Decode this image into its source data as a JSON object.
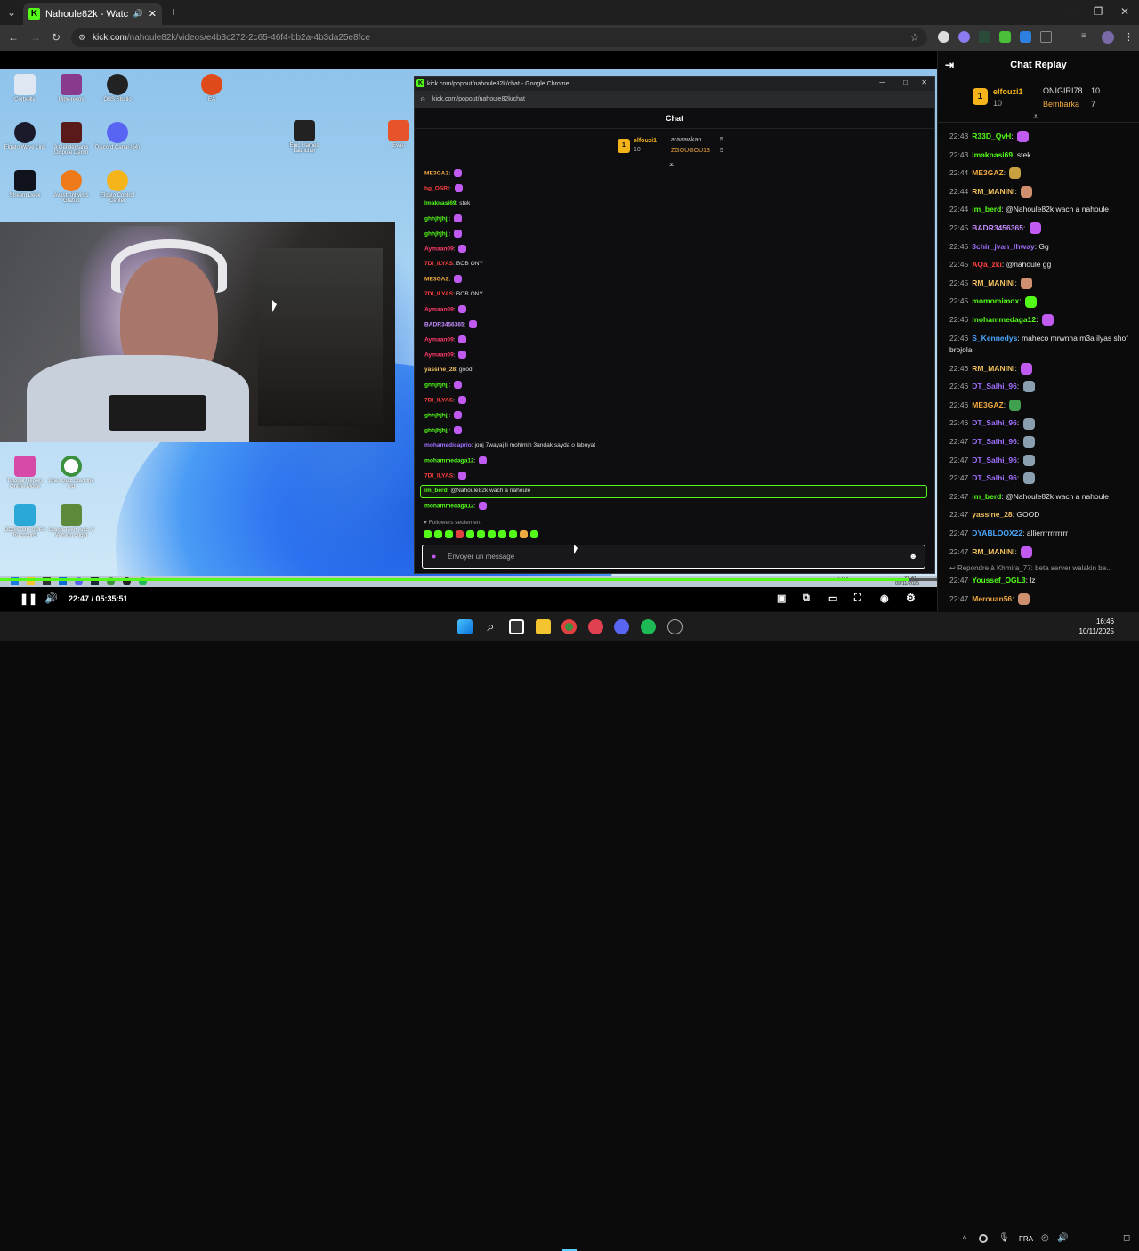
{
  "browser": {
    "tab_title": "Nahoule82k - Watch the VO",
    "url_domain": "kick.com",
    "url_path": "/nahoule82k/videos/e4b3c272-2c65-46f4-bb2a-4b3da25e8fce"
  },
  "desktop_icons": [
    "Corbeille",
    "Ujpy-recov",
    "OBS Studio",
    "EA",
    "Elgato Wave Link",
    "A Gentleman's Dispute Demo",
    "Discord Canal (64)",
    "Epic Games Launcher",
    "Evan",
    "Stream Deck",
    "Avast Antivirus Gratuit",
    "Elgato Control Center",
    "Tutorial Heroes Online Mode",
    "Uber Quiz Start the old",
    "DESKTOP-SUP4 Raccourci",
    "Grand Theft Auto V Version origin"
  ],
  "popout": {
    "title": "kick.com/popout/nahoule82k/chat - Google Chrome",
    "url": "kick.com/popout/nahoule82k/chat",
    "header": "Chat",
    "top_gifters": [
      {
        "rank": "1",
        "name": "elfouzi1",
        "count": "10"
      },
      {
        "name": "araaawkan",
        "count": "5"
      },
      {
        "name": "ZGOUGOU13",
        "count": "5"
      }
    ],
    "messages": [
      {
        "user": "ME3GAZ",
        "text": "",
        "color": "#f0a840"
      },
      {
        "user": "bg_OSRI",
        "text": "",
        "color": "#ff4040"
      },
      {
        "user": "lmaknasi69",
        "text": "stek",
        "color": "#53fc18"
      },
      {
        "user": "ghhjhjhjj",
        "text": "",
        "color": "#53fc18"
      },
      {
        "user": "ghhjhjhjj",
        "text": "",
        "color": "#53fc18"
      },
      {
        "user": "Aymaan09",
        "text": "",
        "color": "#ff3a6a"
      },
      {
        "user": "7DI_ILYAS",
        "text": "BOB ONY",
        "color": "#ff4040"
      },
      {
        "user": "ME3GAZ",
        "text": "",
        "color": "#f0a840"
      },
      {
        "user": "7DI_ILYAS",
        "text": "BOB ONY",
        "color": "#ff4040"
      },
      {
        "user": "Aymaan09",
        "text": "",
        "color": "#ff3a6a"
      },
      {
        "user": "BADR3456365",
        "text": "",
        "color": "#c68cff"
      },
      {
        "user": "Aymaan09",
        "text": "",
        "color": "#ff3a6a"
      },
      {
        "user": "Aymaan09",
        "text": "",
        "color": "#ff3a6a"
      },
      {
        "user": "yassine_28",
        "text": "good",
        "color": "#f0c060"
      },
      {
        "user": "ghhjhjhjj",
        "text": "",
        "color": "#53fc18"
      },
      {
        "user": "7DI_ILYAS",
        "text": "",
        "color": "#ff4040"
      },
      {
        "user": "ghhjhjhjj",
        "text": "",
        "color": "#53fc18"
      },
      {
        "user": "ghhjhjhjj",
        "text": "",
        "color": "#53fc18"
      },
      {
        "user": "mohamedicaprio",
        "text": "jouj 7wayaj li mohimin 3andak sayda o laboyat",
        "color": "#a070ff"
      },
      {
        "user": "mohammedaga12",
        "text": "",
        "color": "#53fc18"
      },
      {
        "user": "7DI_ILYAS",
        "text": "",
        "color": "#ff4040"
      },
      {
        "user": "im_berd",
        "text": "@Nahoule82k wach a nahoule",
        "color": "#53fc18"
      },
      {
        "user": "mohammedaga12",
        "text": "",
        "color": "#53fc18"
      }
    ],
    "followers_only": "Followers seulement",
    "input_placeholder": "Envoyer un message"
  },
  "player": {
    "time": "22:47 / 05:35:51",
    "progress": 0.97
  },
  "replay": {
    "header": "Chat Replay",
    "top_gifters": [
      {
        "rank": "1",
        "name": "elfouzi1",
        "count": "10"
      },
      {
        "name": "ONIGIRI78",
        "count": "10"
      },
      {
        "name": "Bembarka",
        "count": "7"
      }
    ],
    "messages": [
      {
        "time": "22:43",
        "user": "R33D_QvH",
        "text": "",
        "color": "#53fc18",
        "emote": "#c05af0"
      },
      {
        "time": "22:43",
        "user": "lmaknasi69",
        "text": "stek",
        "color": "#53fc18"
      },
      {
        "time": "22:44",
        "user": "ME3GAZ",
        "text": "",
        "color": "#f0a840",
        "emote": "#c8a040"
      },
      {
        "time": "22:44",
        "user": "RM_MANINI",
        "text": "",
        "color": "#f0c060",
        "emote": "#d09070"
      },
      {
        "time": "22:44",
        "user": "im_berd",
        "text": "@Nahoule82k wach a nahoule",
        "color": "#53fc18"
      },
      {
        "time": "22:45",
        "user": "BADR3456365",
        "text": "",
        "color": "#c68cff",
        "emote": "#c05af0"
      },
      {
        "time": "22:45",
        "user": "3chir_jvan_lhway",
        "text": "Gg",
        "color": "#a070ff"
      },
      {
        "time": "22:45",
        "user": "AQa_zki",
        "text": "@nahoule gg",
        "color": "#ff4040"
      },
      {
        "time": "22:45",
        "user": "RM_MANINI",
        "text": "",
        "color": "#f0c060",
        "emote": "#d09070"
      },
      {
        "time": "22:45",
        "user": "momomimox",
        "text": "",
        "color": "#53fc18",
        "emote": "#53fc18"
      },
      {
        "time": "22:46",
        "user": "mohammedaga12",
        "text": "",
        "color": "#53fc18",
        "emote": "#c05af0"
      },
      {
        "time": "22:46",
        "user": "S_Kennedys",
        "text": "maheco mrwnha m3a ilyas shof brojola",
        "color": "#4aa8ff"
      },
      {
        "time": "22:46",
        "user": "RM_MANINI",
        "text": "",
        "color": "#f0c060",
        "emote": "#c05af0"
      },
      {
        "time": "22:46",
        "user": "DT_Salhi_96",
        "text": "",
        "color": "#a070ff",
        "emote": "#8aa0b0"
      },
      {
        "time": "22:46",
        "user": "ME3GAZ",
        "text": "",
        "color": "#f0a840",
        "emote": "#40a050"
      },
      {
        "time": "22:46",
        "user": "DT_Salhi_96",
        "text": "",
        "color": "#a070ff",
        "emote": "#8aa0b0"
      },
      {
        "time": "22:47",
        "user": "DT_Salhi_96",
        "text": "",
        "color": "#a070ff",
        "emote": "#8aa0b0"
      },
      {
        "time": "22:47",
        "user": "DT_Salhi_96",
        "text": "",
        "color": "#a070ff",
        "emote": "#8aa0b0"
      },
      {
        "time": "22:47",
        "user": "DT_Salhi_96",
        "text": "",
        "color": "#a070ff",
        "emote": "#8aa0b0"
      },
      {
        "time": "22:47",
        "user": "im_berd",
        "text": "@Nahoule82k wach a nahoule",
        "color": "#53fc18"
      },
      {
        "time": "22:47",
        "user": "yassine_28",
        "text": "GOOD",
        "color": "#f0c060"
      },
      {
        "time": "22:47",
        "user": "DYABLOOX22",
        "text": "allierrrrrrrrrrr",
        "color": "#4aa8ff"
      },
      {
        "time": "22:47",
        "user": "RM_MANINI",
        "text": "",
        "color": "#f0c060",
        "emote": "#c05af0"
      }
    ],
    "reply_hint": "Répondre à Khmira_77: beta server walakin be...",
    "messages_after": [
      {
        "time": "22:47",
        "user": "Youssef_OGL3",
        "text": "lz",
        "color": "#53fc18"
      },
      {
        "time": "22:47",
        "user": "Merouan56",
        "text": "",
        "color": "#f0a840",
        "emote": "#d09070"
      }
    ]
  },
  "inner_taskbar": {
    "time": "22:41",
    "date": "09/11/2025",
    "lang": "FRA"
  },
  "taskbar": {
    "lang": "FRA",
    "time": "16:46",
    "date": "10/11/2025"
  }
}
